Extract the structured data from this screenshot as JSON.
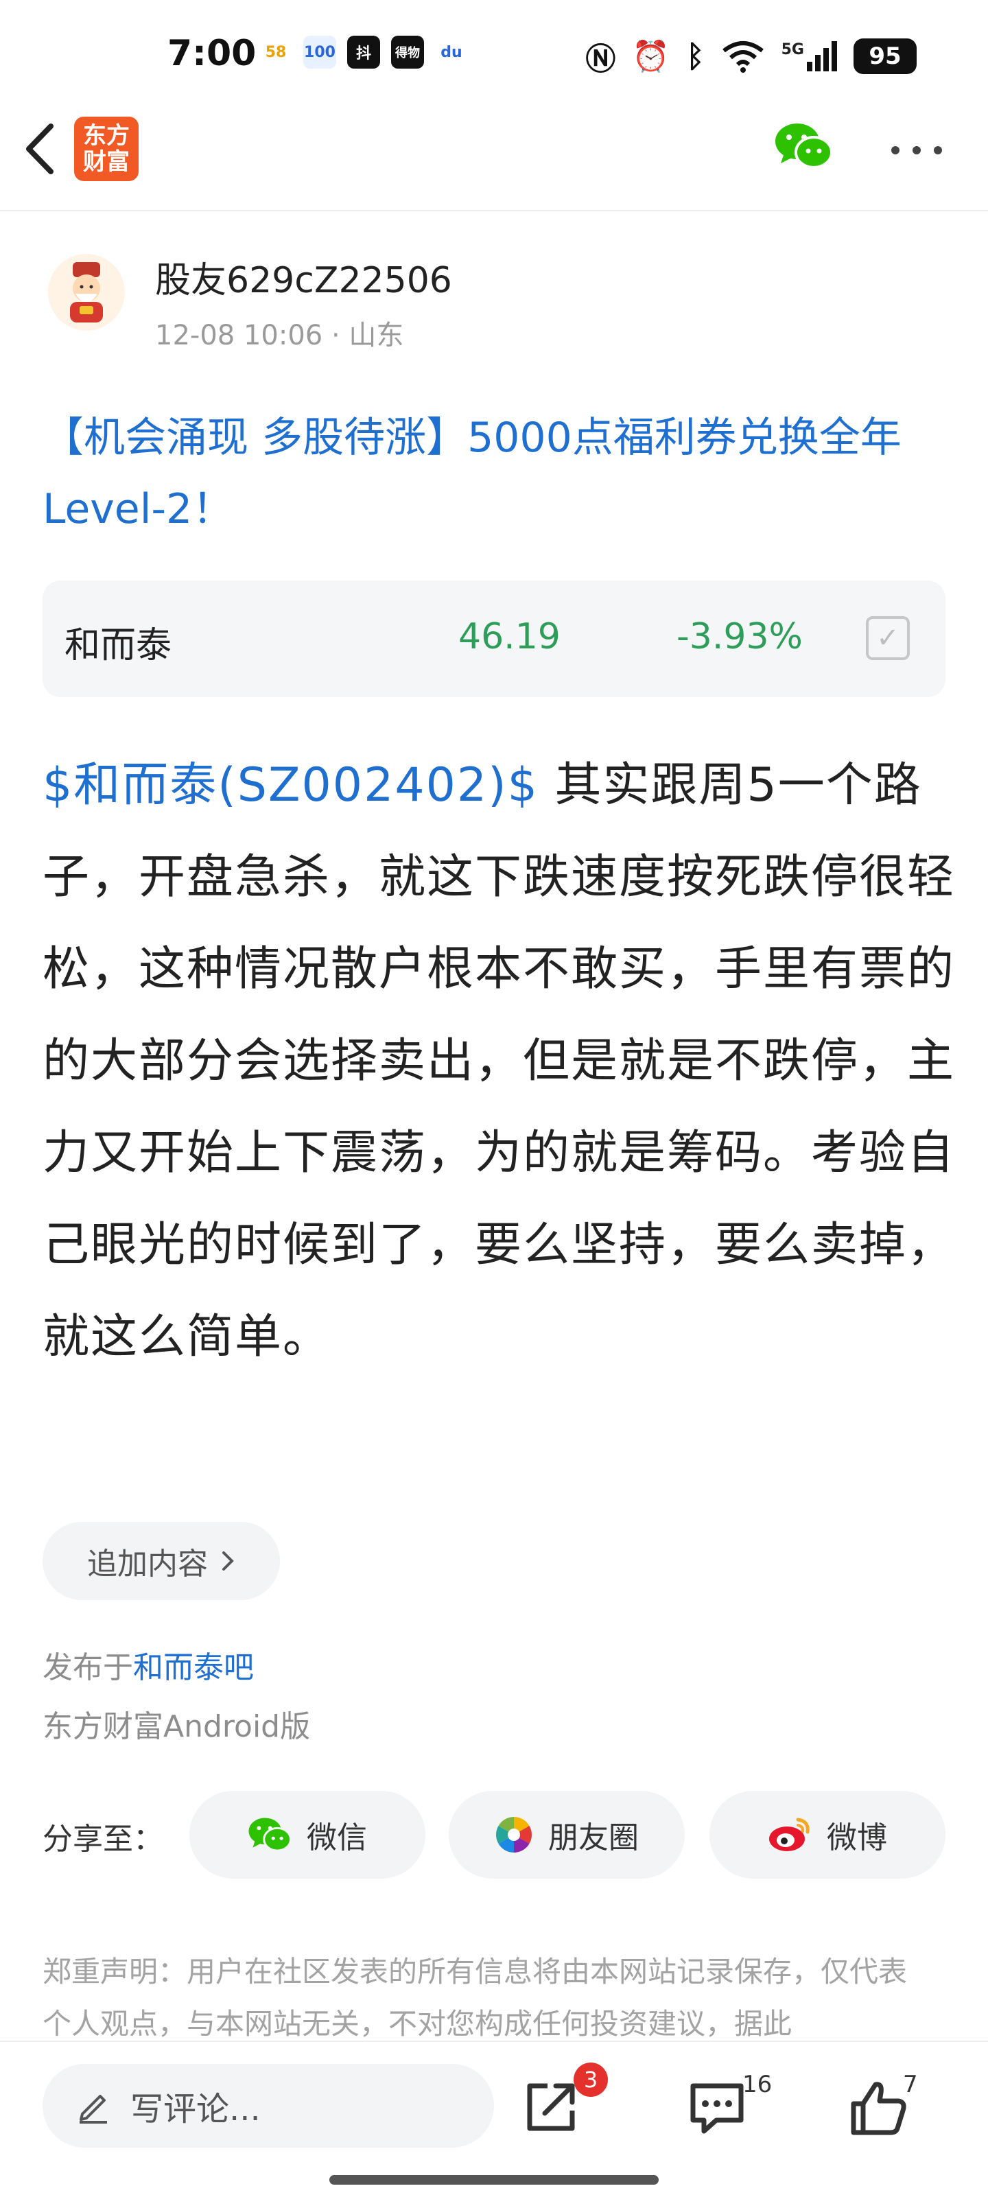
{
  "status_bar": {
    "time": "7:00",
    "apps": [
      "58",
      "100",
      "抖",
      "得物",
      "du"
    ],
    "network": "5G",
    "battery": "95"
  },
  "nav": {
    "logo_line1": "东方",
    "logo_line2": "财富"
  },
  "author": {
    "name": "股友629cZ22506",
    "date": "12-08 10:06",
    "location": "· 山东"
  },
  "post": {
    "title": "【机会涌现 多股待涨】5000点福利券兑换全年Level-2！",
    "stock_link": "$和而泰(SZ002402)$",
    "body": "其实跟周5一个路子，开盘急杀，就这下跌速度按死跌停很轻松，这种情况散户根本不敢买，手里有票的的大部分会选择卖出，但是就是不跌停，主力又开始上下震荡，为的就是筹码。考验自己眼光的时候到了，要么坚持，要么卖掉，就这么简单。"
  },
  "stock_card": {
    "name": "和而泰",
    "price": "46.19",
    "change": "-3.93%",
    "color": "#2e9d5a"
  },
  "append": {
    "label": "追加内容"
  },
  "published": {
    "prefix": "发布于",
    "bar": "和而泰吧",
    "platform": "东方财富Android版"
  },
  "share": {
    "label": "分享至：",
    "wechat": "微信",
    "moments": "朋友圈",
    "weibo": "微博"
  },
  "disclaimer": "郑重声明：用户在社区发表的所有信息将由本网站记录保存，仅代表个人观点，与本网站无关，不对您构成任何投资建议，据此",
  "bottom": {
    "comment_placeholder": "写评论...",
    "share_badge": "3",
    "comment_count": "16",
    "like_count": "7"
  },
  "colors": {
    "link_blue": "#1f6fd1",
    "brand_orange": "#f15a24",
    "badge_red": "#e5312c",
    "wechat_green": "#2dc100"
  }
}
